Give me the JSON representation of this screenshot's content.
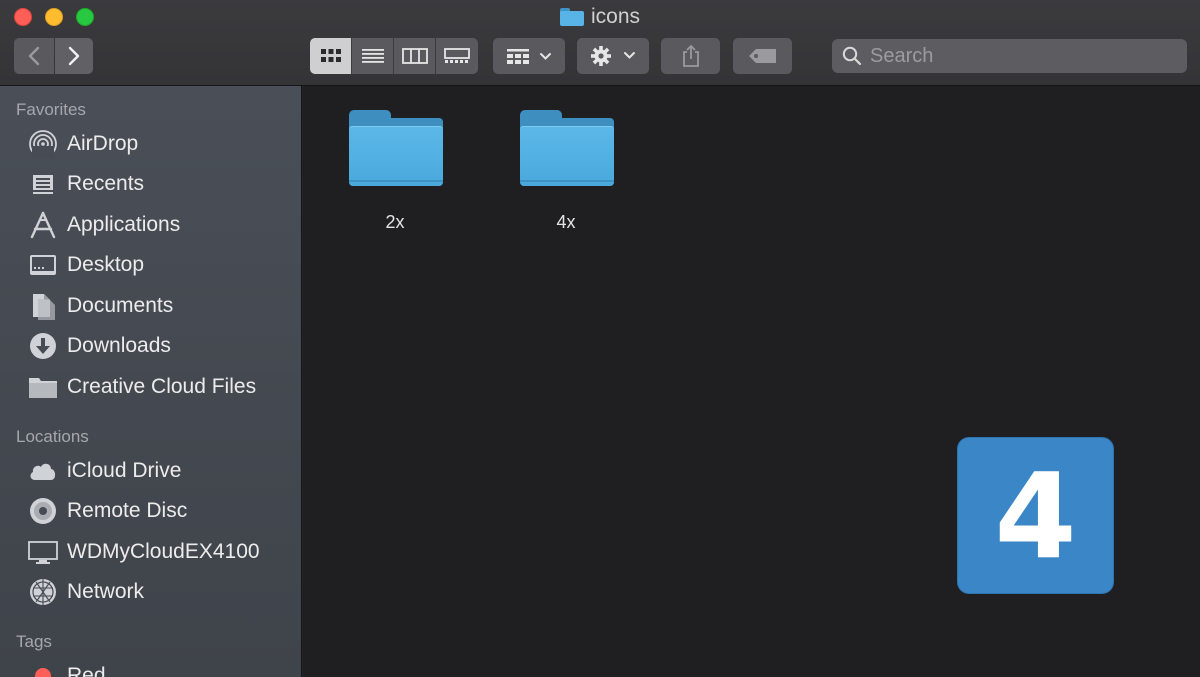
{
  "window": {
    "title": "icons"
  },
  "toolbar": {
    "search_placeholder": "Search",
    "view_modes": [
      "icon-view",
      "list-view",
      "column-view",
      "gallery-view"
    ],
    "selected_view": "icon-view"
  },
  "sidebar": {
    "favorites_heading": "Favorites",
    "favorites": [
      {
        "label": "AirDrop",
        "icon": "airdrop-icon"
      },
      {
        "label": "Recents",
        "icon": "recents-icon"
      },
      {
        "label": "Applications",
        "icon": "applications-icon"
      },
      {
        "label": "Desktop",
        "icon": "desktop-icon"
      },
      {
        "label": "Documents",
        "icon": "documents-icon"
      },
      {
        "label": "Downloads",
        "icon": "downloads-icon"
      },
      {
        "label": "Creative Cloud Files",
        "icon": "folder-icon"
      }
    ],
    "locations_heading": "Locations",
    "locations": [
      {
        "label": "iCloud Drive",
        "icon": "cloud-icon"
      },
      {
        "label": "Remote Disc",
        "icon": "disc-icon"
      },
      {
        "label": "WDMyCloudEX4100",
        "icon": "monitor-icon"
      },
      {
        "label": "Network",
        "icon": "network-icon"
      }
    ],
    "tags_heading": "Tags",
    "tags": [
      {
        "label": "Red",
        "color": "#ff5f57"
      }
    ]
  },
  "content": {
    "items": [
      {
        "name": "2x",
        "type": "folder"
      },
      {
        "name": "4x",
        "type": "folder"
      }
    ]
  },
  "overlay_badge": {
    "text": "4",
    "color": "#3a86c6"
  }
}
